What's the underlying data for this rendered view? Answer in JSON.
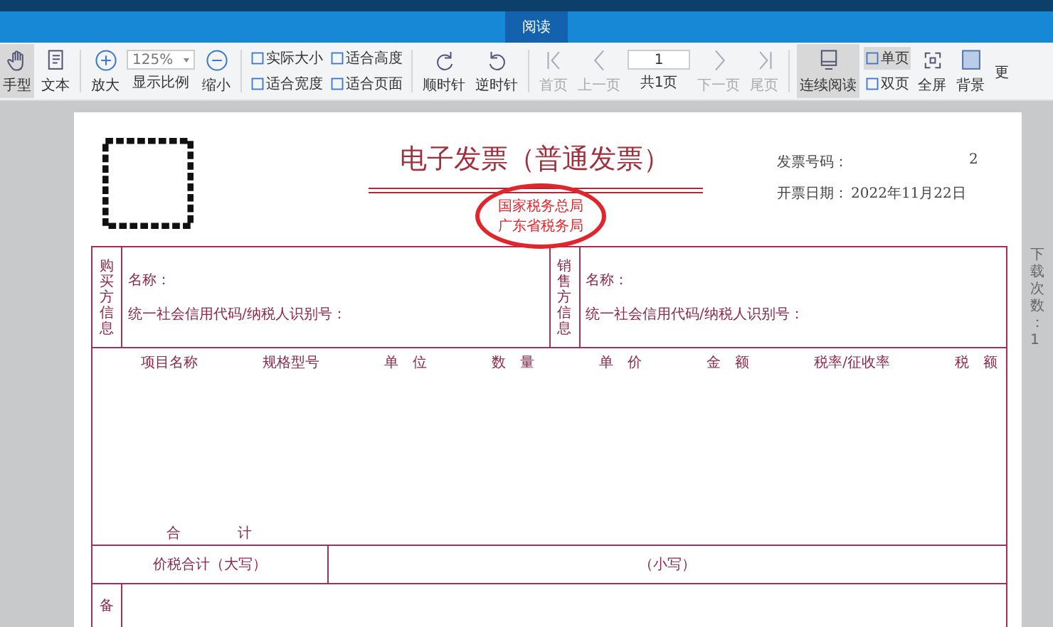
{
  "tabs": [
    {
      "label": "阅读",
      "selected": true
    }
  ],
  "toolbar": [
    {
      "kind": "button",
      "label": "手型",
      "selected": true,
      "disabled": false
    },
    {
      "kind": "button",
      "label": "文本",
      "selected": false,
      "disabled": false
    },
    {
      "kind": "separator"
    },
    {
      "kind": "button",
      "label": "放大",
      "selected": false,
      "disabled": false
    },
    {
      "kind": "zoom",
      "value": "125%",
      "label": "显示比例"
    },
    {
      "kind": "button",
      "label": "缩小",
      "selected": false,
      "disabled": false
    },
    {
      "kind": "separator"
    },
    {
      "kind": "pair",
      "items": [
        {
          "label": "实际大小",
          "selected": false
        },
        {
          "label": "适合宽度",
          "selected": false
        }
      ]
    },
    {
      "kind": "pair",
      "items": [
        {
          "label": "适合高度",
          "selected": false
        },
        {
          "label": "适合页面",
          "selected": false
        }
      ]
    },
    {
      "kind": "separator"
    },
    {
      "kind": "button",
      "label": "顺时针",
      "selected": false,
      "disabled": false
    },
    {
      "kind": "button",
      "label": "逆时针",
      "selected": false,
      "disabled": false
    },
    {
      "kind": "separator"
    },
    {
      "kind": "button",
      "label": "首页",
      "selected": false,
      "disabled": true
    },
    {
      "kind": "button",
      "label": "上一页",
      "selected": false,
      "disabled": true
    },
    {
      "kind": "pager",
      "value": "1",
      "label": "共1页"
    },
    {
      "kind": "button",
      "label": "下一页",
      "selected": false,
      "disabled": true
    },
    {
      "kind": "button",
      "label": "尾页",
      "selected": false,
      "disabled": true
    },
    {
      "kind": "separator"
    },
    {
      "kind": "button",
      "label": "连续阅读",
      "selected": true,
      "disabled": false
    },
    {
      "kind": "pair",
      "items": [
        {
          "label": "单页",
          "selected": true
        },
        {
          "label": "双页",
          "selected": false
        }
      ]
    },
    {
      "kind": "button",
      "label": "全屏",
      "selected": false,
      "disabled": false
    },
    {
      "kind": "button",
      "label": "背景",
      "selected": false,
      "disabled": false
    },
    {
      "kind": "button",
      "label": "更",
      "selected": false,
      "disabled": false
    }
  ],
  "invoice": {
    "title": "电子发票（普通发票）",
    "stamp": [
      "国家税务总局",
      "广东省税务局"
    ],
    "number_label": "发票号码：",
    "number_value": "2",
    "date_label": "开票日期：",
    "date_value": "2022年11月22日",
    "parties": [
      {
        "label": "购买方信息",
        "fields": [
          "名称：",
          "统一社会信用代码/纳税人识别号："
        ]
      },
      {
        "label": "销售方信息",
        "fields": [
          "名称：",
          "统一社会信用代码/纳税人识别号："
        ]
      }
    ],
    "columns": [
      "项目名称",
      "规格型号",
      "单　位",
      "数　量",
      "单　价",
      "金　额",
      "税率/征收率",
      "税　额"
    ],
    "total_label": "合　　　　计",
    "sum_label": "价税合计（大写）",
    "sum_small_label": "（小写）",
    "remarks_label": "备"
  },
  "side_note": "下载次数：1"
}
